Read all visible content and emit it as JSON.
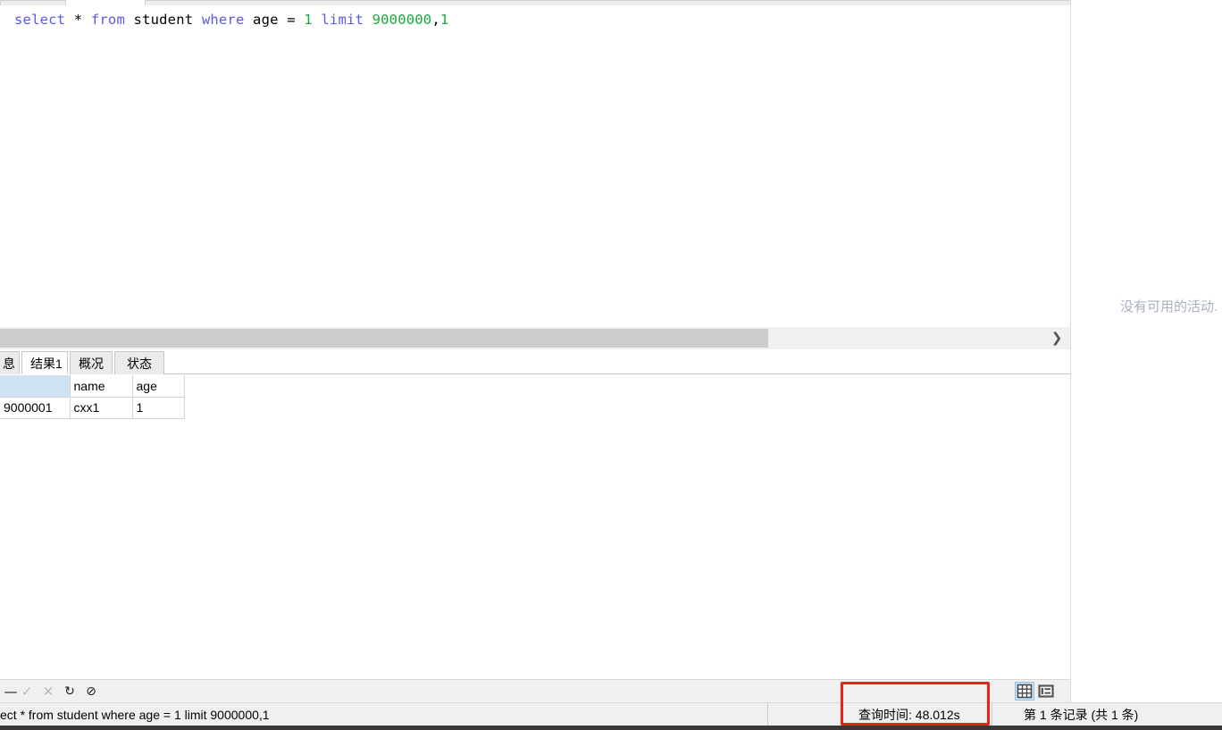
{
  "editor": {
    "sql_tokens": [
      {
        "text": "select",
        "type": "keyword"
      },
      {
        "text": " ",
        "type": "plain"
      },
      {
        "text": "*",
        "type": "operator"
      },
      {
        "text": " ",
        "type": "plain"
      },
      {
        "text": "from",
        "type": "keyword"
      },
      {
        "text": " ",
        "type": "plain"
      },
      {
        "text": "student",
        "type": "identifier"
      },
      {
        "text": " ",
        "type": "plain"
      },
      {
        "text": "where",
        "type": "keyword"
      },
      {
        "text": " ",
        "type": "plain"
      },
      {
        "text": "age",
        "type": "identifier"
      },
      {
        "text": " ",
        "type": "plain"
      },
      {
        "text": "=",
        "type": "operator"
      },
      {
        "text": " ",
        "type": "plain"
      },
      {
        "text": "1",
        "type": "number"
      },
      {
        "text": " ",
        "type": "plain"
      },
      {
        "text": "limit",
        "type": "keyword"
      },
      {
        "text": " ",
        "type": "plain"
      },
      {
        "text": "9000000",
        "type": "number"
      },
      {
        "text": ",",
        "type": "operator"
      },
      {
        "text": "1",
        "type": "number"
      }
    ],
    "sql_full_text": "select * from student where age = 1 limit 9000000,1",
    "keyword_color": "#5a5ae6",
    "number_color": "#1aaa3c",
    "identifier_color": "#000000",
    "scroll_right_arrow": "❯"
  },
  "result_tabs": [
    {
      "label": "息",
      "active": false,
      "name": "tab-info"
    },
    {
      "label": "结果1",
      "active": true,
      "name": "tab-result-1"
    },
    {
      "label": "概况",
      "active": false,
      "name": "tab-profile"
    },
    {
      "label": "状态",
      "active": false,
      "name": "tab-status"
    }
  ],
  "grid": {
    "columns": [
      "",
      "name",
      "age"
    ],
    "rows": [
      {
        "id": "9000001",
        "name": "cxx1",
        "age": "1"
      }
    ],
    "selected_header_color": "#cfe3f5"
  },
  "grid_toolbar": {
    "icons": [
      {
        "name": "minus-icon",
        "glyph": "—",
        "enabled": true
      },
      {
        "name": "check-icon",
        "glyph": "✓",
        "enabled": false
      },
      {
        "name": "cross-icon",
        "glyph": "✕",
        "enabled": false
      },
      {
        "name": "refresh-icon",
        "glyph": "↻",
        "enabled": true
      },
      {
        "name": "stop-icon",
        "glyph": "⊘",
        "enabled": true
      }
    ],
    "view_grid_label": "grid-view",
    "view_form_label": "form-view"
  },
  "status_bar": {
    "sql_text": "ect * from student where age = 1 limit 9000000,1",
    "query_time": "查询时间: 48.012s",
    "record_count": "第 1 条记录 (共 1 条)"
  },
  "right_panel": {
    "empty_message": "没有可用的活动."
  },
  "annotation": {
    "color": "#ef2015",
    "target": "query-time"
  }
}
